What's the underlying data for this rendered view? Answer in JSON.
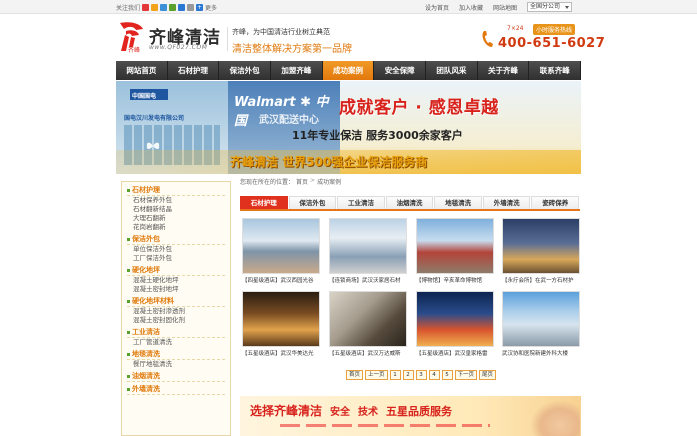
{
  "topbar": {
    "follow_label": "关注我们",
    "more_label": "更多",
    "links": [
      "设为首页",
      "加入收藏",
      "网站地图"
    ],
    "branch_select": "全国分公司"
  },
  "header": {
    "logo_cn": "齐峰清洁",
    "logo_url": "www.QF027.COM",
    "logo_badge": "齐峰",
    "slogan_line1": "齐峰，为中国清洁行业树立典范",
    "slogan_line2": "清洁整体解决方案第一品牌",
    "service_hours": "7×24",
    "hotline_badge": "小时服务热线",
    "hotline_number": "400-651-6027"
  },
  "nav": {
    "items": [
      "网站首页",
      "石材护理",
      "保洁外包",
      "加盟齐峰",
      "成功案例",
      "安全保障",
      "团队风采",
      "关于齐峰",
      "联系齐峰"
    ],
    "active_index": 4
  },
  "banner": {
    "left_company": "国电汉川发电有限公司",
    "left_logo": "中国国电",
    "walmart_text": "Walmart ✱ 中国",
    "walmart_sub": "武汉配送中心",
    "headline": "成就客户 · 感恩卓越",
    "subline": "11年专业保洁 服务3000余家客户",
    "bottom_line": "齐峰清洁 世界500强企业保洁服务商"
  },
  "sidebar": {
    "groups": [
      {
        "title": "石材护理",
        "items": [
          "石材保养外包",
          "石材翻新结晶",
          "大理石翻新",
          "花岗岩翻新"
        ]
      },
      {
        "title": "保洁外包",
        "items": [
          "单位保洁外包",
          "工厂保洁外包"
        ]
      },
      {
        "title": "硬化地坪",
        "items": [
          "混凝土硬化地坪",
          "混凝土密封地坪"
        ]
      },
      {
        "title": "硬化地坪材料",
        "items": [
          "混凝土密封渗透剂",
          "混凝土密封固化剂"
        ]
      },
      {
        "title": "工业清洁",
        "items": [
          "工厂管道清洗"
        ]
      },
      {
        "title": "地毯清洗",
        "items": [
          "餐厅地毯清洗"
        ]
      },
      {
        "title": "油烟清洗",
        "items": []
      },
      {
        "title": "外墙清洗",
        "items": []
      }
    ]
  },
  "breadcrumb": {
    "prefix": "您现在所在的位置：",
    "home": "首页",
    "sep": ">",
    "current": "成功案例"
  },
  "subtabs": {
    "items": [
      "石材护理",
      "保洁外包",
      "工业清洁",
      "油烟清洗",
      "地毯清洗",
      "外墙清洗",
      "瓷砖保养"
    ],
    "active_index": 0
  },
  "cases": [
    {
      "caption": "【四星级酒店】武汉西园光谷"
    },
    {
      "caption": "【连锁商场】武汉沃家居石材"
    },
    {
      "caption": "【博物馆】辛亥革命博物馆"
    },
    {
      "caption": "【永疗会所】在武一方石材护"
    },
    {
      "caption": "【五星级酒店】武汉华美达光"
    },
    {
      "caption": "【五星级酒店】武汉万达威斯"
    },
    {
      "caption": "【五星级酒店】武汉皇家格雷"
    },
    {
      "caption": "武汉协和医院新建外科大楼"
    }
  ],
  "pager": {
    "first": "首页",
    "prev": "上一页",
    "pages": [
      "1",
      "2",
      "3",
      "4",
      "5"
    ],
    "next": "下一页",
    "last": "尾页"
  },
  "promo": {
    "t1": "选择齐峰清洁",
    "t2": "安全",
    "t3": "技术",
    "t4": "五星品质服务"
  },
  "colors": {
    "accent_orange": "#e2780d",
    "nav_dark": "#303030",
    "brand_red": "#d8221c",
    "sidebar_title": "#e07a0c"
  }
}
